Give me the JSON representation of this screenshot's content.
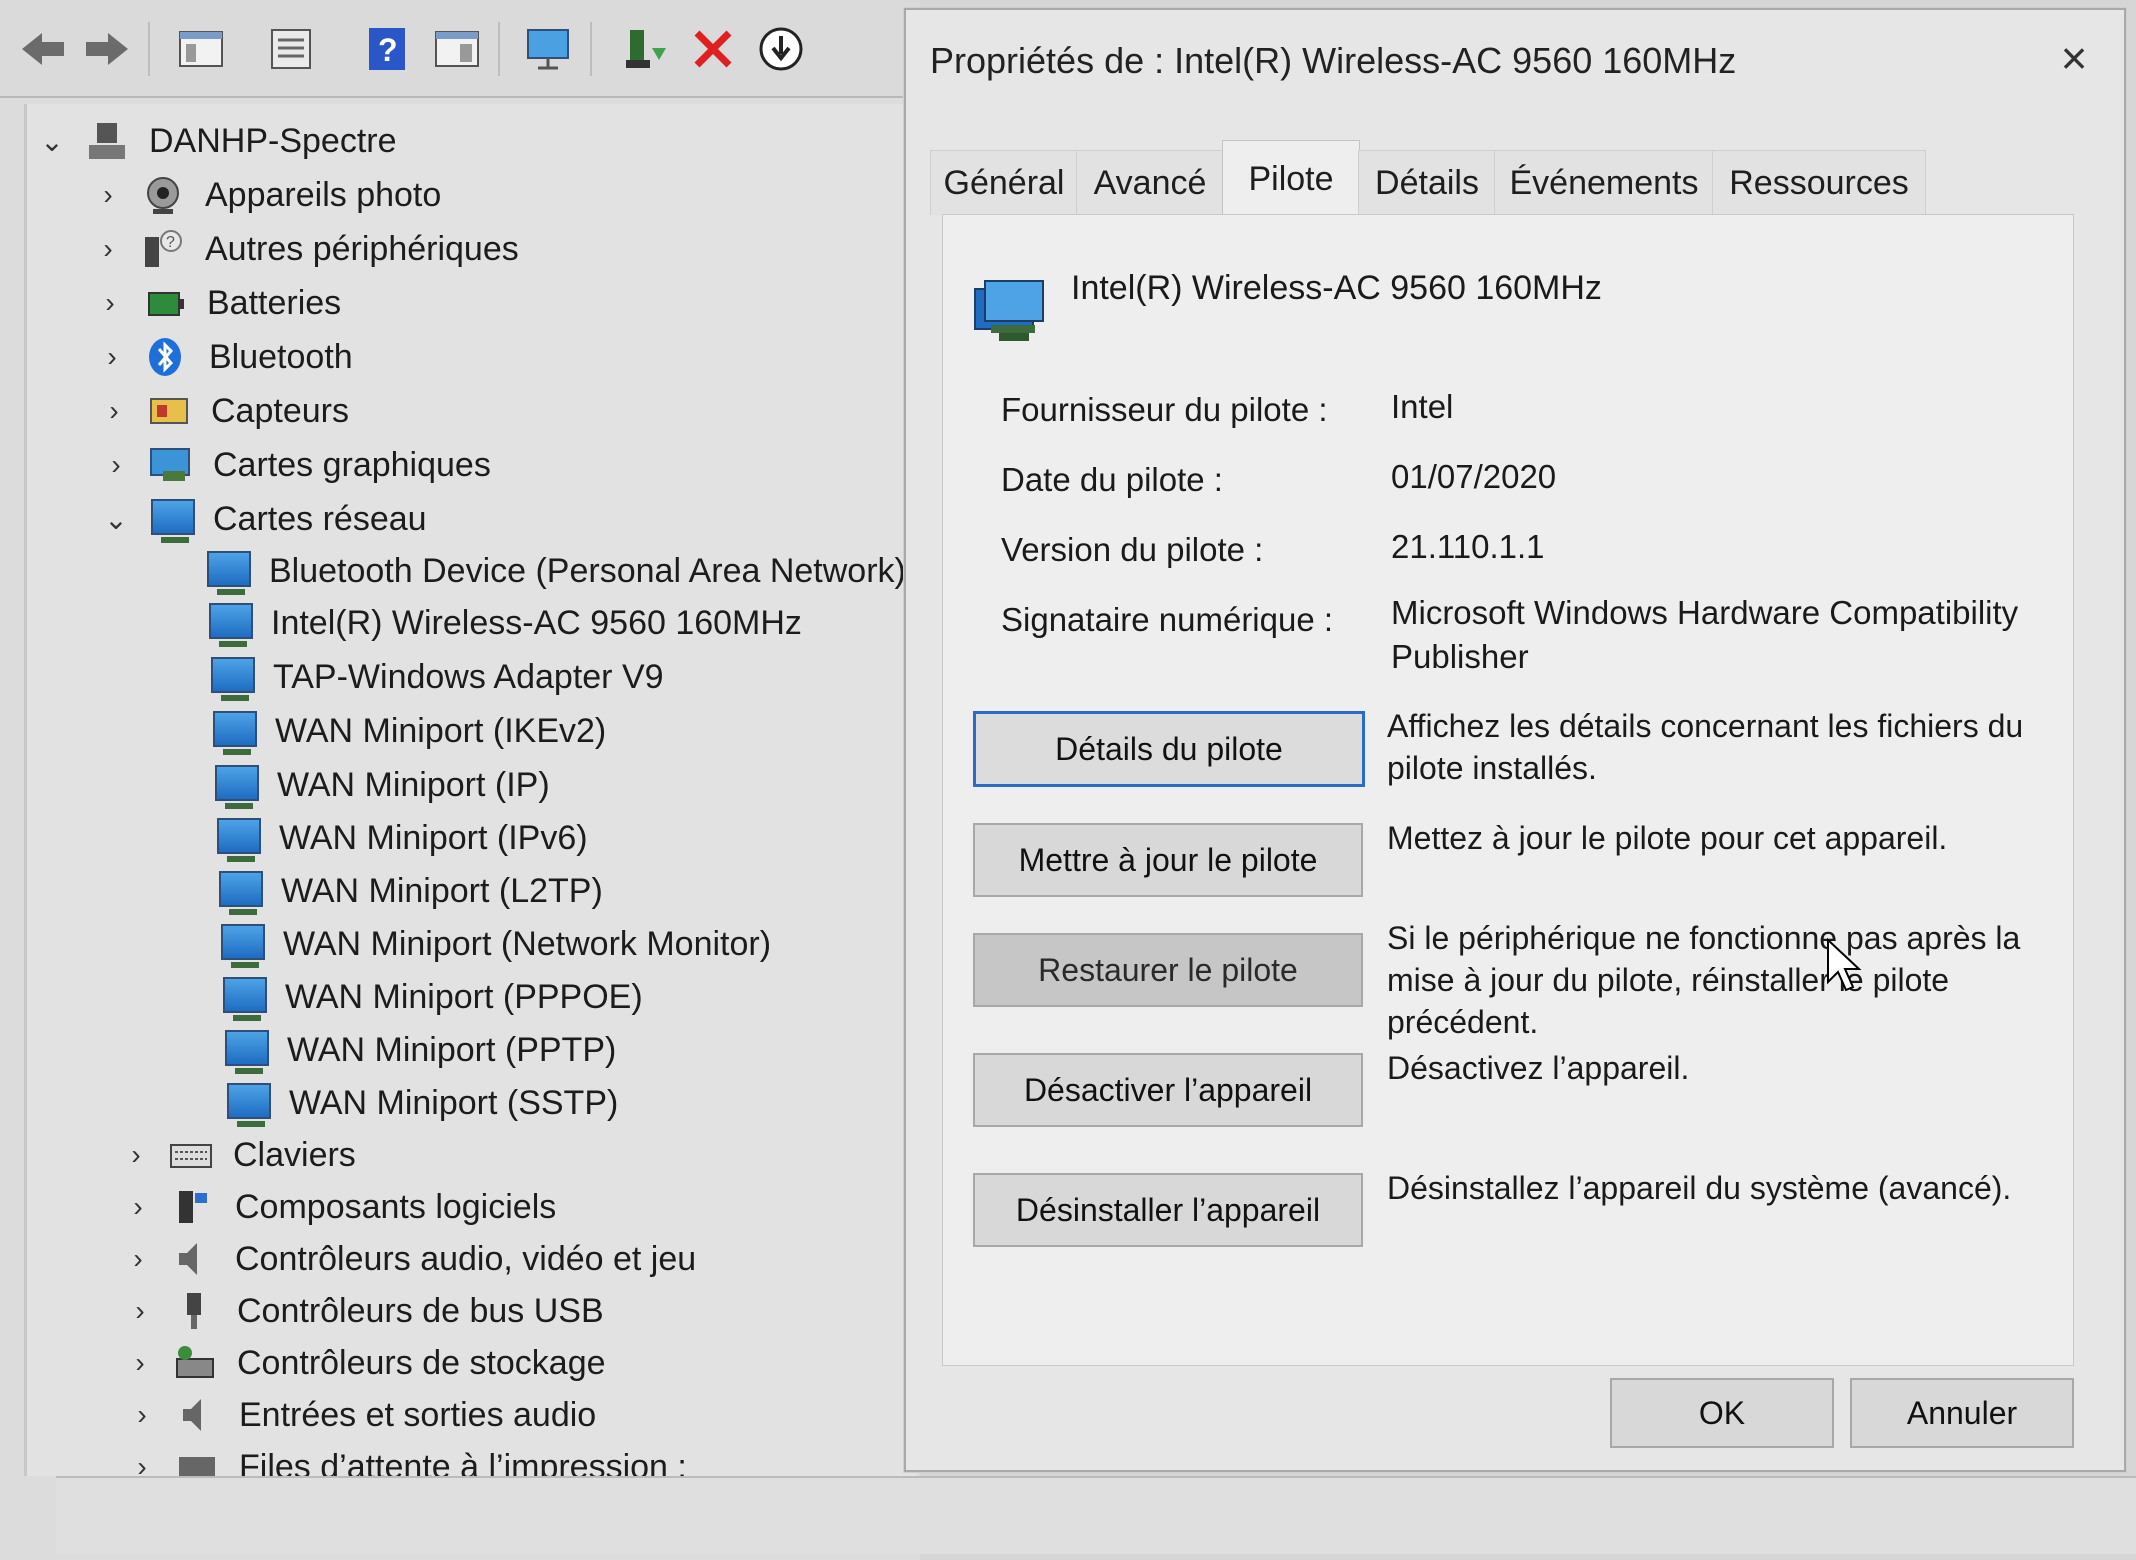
{
  "device_manager": {
    "toolbar": [
      {
        "icon": "back-arrow-icon"
      },
      {
        "icon": "forward-arrow-icon"
      },
      {
        "icon": "show-hide-tree-icon"
      },
      {
        "icon": "properties-icon"
      },
      {
        "icon": "help-icon"
      },
      {
        "icon": "view-panel-icon"
      },
      {
        "icon": "scan-hardware-icon"
      },
      {
        "icon": "add-driver-icon"
      },
      {
        "icon": "uninstall-x-icon"
      },
      {
        "icon": "update-driver-icon"
      }
    ],
    "root": "DANHP-Spectre",
    "categories_top": [
      {
        "label": "Appareils photo",
        "icon": "camera-icon"
      },
      {
        "label": "Autres périphériques",
        "icon": "unknown-device-icon"
      },
      {
        "label": "Batteries",
        "icon": "battery-icon"
      },
      {
        "label": "Bluetooth",
        "icon": "bluetooth-icon"
      },
      {
        "label": "Capteurs",
        "icon": "sensor-icon"
      },
      {
        "label": "Cartes graphiques",
        "icon": "display-adapter-icon"
      }
    ],
    "network_category": "Cartes réseau",
    "network_devices": [
      "Bluetooth Device (Personal Area Network)",
      "Intel(R) Wireless-AC 9560 160MHz",
      "TAP-Windows Adapter V9",
      "WAN Miniport (IKEv2)",
      "WAN Miniport (IP)",
      "WAN Miniport (IPv6)",
      "WAN Miniport (L2TP)",
      "WAN Miniport (Network Monitor)",
      "WAN Miniport (PPPOE)",
      "WAN Miniport (PPTP)",
      "WAN Miniport (SSTP)"
    ],
    "categories_bottom": [
      {
        "label": "Claviers",
        "icon": "keyboard-icon"
      },
      {
        "label": "Composants logiciels",
        "icon": "software-component-icon"
      },
      {
        "label": "Contrôleurs audio, vidéo et jeu",
        "icon": "speaker-icon"
      },
      {
        "label": "Contrôleurs de bus USB",
        "icon": "usb-icon"
      },
      {
        "label": "Contrôleurs de stockage",
        "icon": "storage-icon"
      },
      {
        "label": "Entrées et sorties audio",
        "icon": "audio-io-icon"
      },
      {
        "label": "Files d’attente à l’impression :",
        "icon": "printer-queue-icon"
      }
    ]
  },
  "dialog": {
    "title": "Propriétés de : Intel(R) Wireless-AC 9560 160MHz",
    "close": "×",
    "tabs": [
      "Général",
      "Avancé",
      "Pilote",
      "Détails",
      "Événements",
      "Ressources"
    ],
    "active_tab": "Pilote",
    "device_name": "Intel(R) Wireless-AC 9560 160MHz",
    "props": [
      {
        "label": "Fournisseur du pilote :",
        "value": "Intel"
      },
      {
        "label": "Date du pilote :",
        "value": "01/07/2020"
      },
      {
        "label": "Version du pilote :",
        "value": "21.110.1.1"
      },
      {
        "label": "Signataire numérique :",
        "value": "Microsoft Windows Hardware Compatibility Publisher"
      }
    ],
    "actions": [
      {
        "button": "Détails du pilote",
        "description": "Affichez les détails concernant les fichiers du pilote installés."
      },
      {
        "button": "Mettre à jour le pilote",
        "description": "Mettez à jour le pilote pour cet appareil."
      },
      {
        "button": "Restaurer le pilote",
        "description": "Si le périphérique ne fonctionne pas après la mise à jour du pilote, réinstaller le pilote précédent."
      },
      {
        "button": "Désactiver l’appareil",
        "description": "Désactivez l’appareil."
      },
      {
        "button": "Désinstaller l’appareil",
        "description": "Désinstallez l’appareil du système (avancé)."
      }
    ],
    "ok": "OK",
    "cancel": "Annuler"
  }
}
